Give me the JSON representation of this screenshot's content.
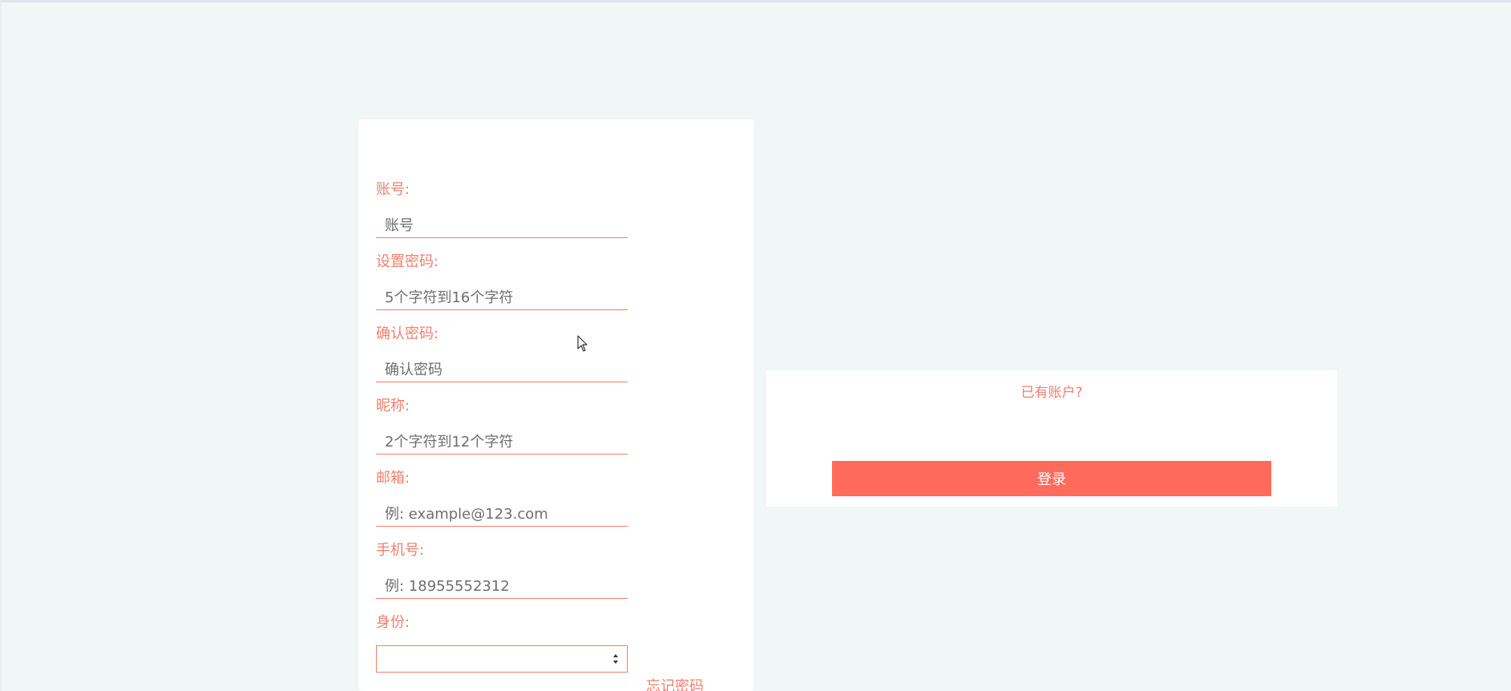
{
  "register": {
    "fields": [
      {
        "label": "账号:",
        "placeholder": "账号"
      },
      {
        "label": "设置密码:",
        "placeholder": "5个字符到16个字符"
      },
      {
        "label": "确认密码:",
        "placeholder": "确认密码"
      },
      {
        "label": "昵称:",
        "placeholder": "2个字符到12个字符"
      },
      {
        "label": "邮箱:",
        "placeholder": "例: example@123.com"
      },
      {
        "label": "手机号:",
        "placeholder": "例: 18955552312"
      }
    ],
    "identity_label": "身份:",
    "identity_value": "",
    "forgot_password": "忘记密码"
  },
  "login": {
    "have_account": "已有账户?",
    "button_label": "登录"
  },
  "colors": {
    "accent": "#f07f6f",
    "button": "#ff6b5b",
    "background": "#f1f6f7"
  }
}
